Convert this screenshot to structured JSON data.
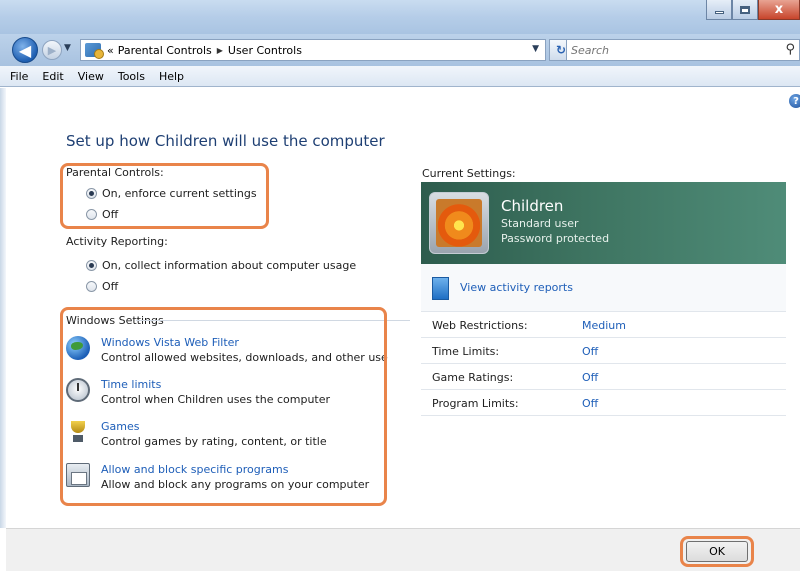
{
  "window": {
    "close_glyph": "x"
  },
  "address": {
    "prefix": "«",
    "crumbs": [
      "Parental Controls",
      "User Controls"
    ],
    "search_placeholder": "Search"
  },
  "menu": [
    "File",
    "Edit",
    "View",
    "Tools",
    "Help"
  ],
  "page": {
    "title": "Set up how Children will use the computer"
  },
  "parental_controls": {
    "label": "Parental Controls:",
    "options": [
      {
        "label": "On, enforce current settings",
        "checked": true
      },
      {
        "label": "Off",
        "checked": false
      }
    ]
  },
  "activity_reporting": {
    "label": "Activity Reporting:",
    "options": [
      {
        "label": "On, collect information about computer usage",
        "checked": true
      },
      {
        "label": "Off",
        "checked": false
      }
    ]
  },
  "windows_settings": {
    "label": "Windows Settings",
    "items": [
      {
        "icon": "globe-icon",
        "title": "Windows Vista Web Filter",
        "desc": "Control allowed websites, downloads, and other use"
      },
      {
        "icon": "stopwatch-icon",
        "title": "Time limits",
        "desc": "Control when Children uses the computer"
      },
      {
        "icon": "trophy-icon",
        "title": "Games",
        "desc": "Control games by rating, content, or title"
      },
      {
        "icon": "programs-icon",
        "title": "Allow and block specific programs",
        "desc": "Allow and block any programs on your computer"
      }
    ]
  },
  "current_settings": {
    "label": "Current Settings:",
    "user": {
      "name": "Children",
      "type": "Standard user",
      "password": "Password protected"
    },
    "activity_link": "View activity reports",
    "limits": [
      {
        "key": "Web Restrictions:",
        "value": "Medium"
      },
      {
        "key": "Time Limits:",
        "value": "Off"
      },
      {
        "key": "Game Ratings:",
        "value": "Off"
      },
      {
        "key": "Program Limits:",
        "value": "Off"
      }
    ]
  },
  "footer": {
    "ok_label": "OK"
  },
  "colors": {
    "highlight": "#e9844a",
    "link": "#1e5eb8",
    "title": "#1e3f73",
    "user_panel": "#3e7461"
  }
}
